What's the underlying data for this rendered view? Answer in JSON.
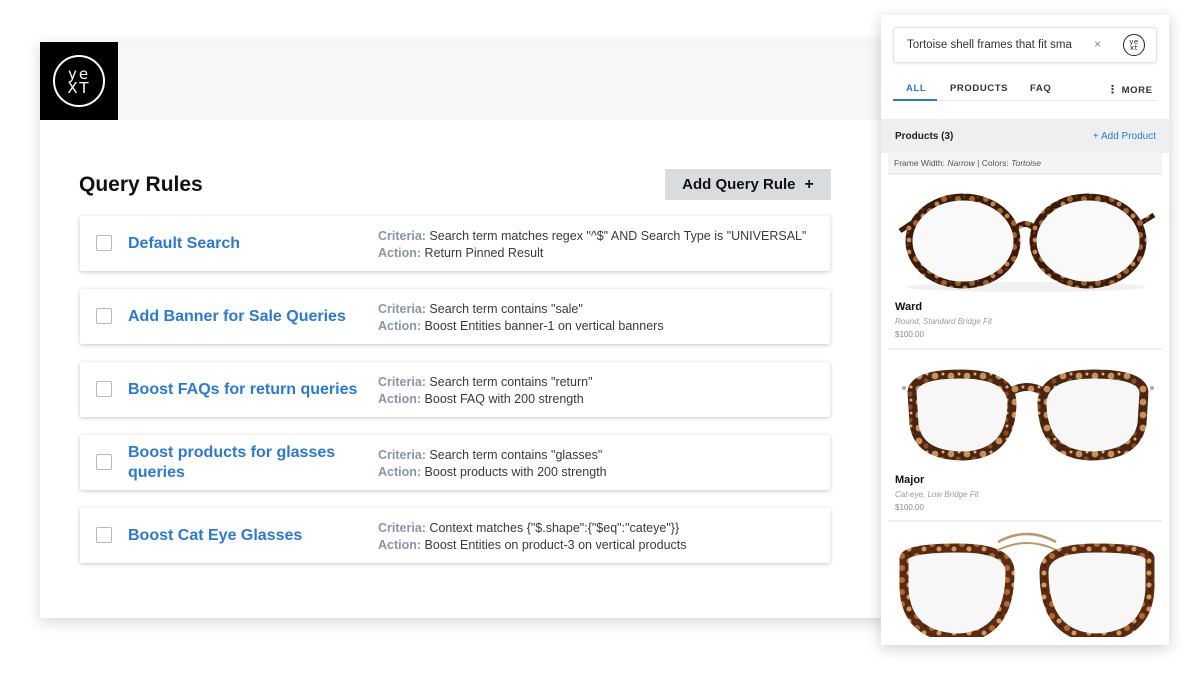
{
  "logo": {
    "line1": "ye",
    "line2": "XT"
  },
  "page": {
    "title": "Query Rules",
    "add_rule_label": "Add Query Rule",
    "add_rule_icon": "+"
  },
  "rules": [
    {
      "name": "Default Search",
      "criteria_label": "Criteria:",
      "criteria": "Search term matches regex \"^$\" AND Search Type is \"UNIVERSAL\"",
      "action_label": "Action:",
      "action": "Return Pinned Result"
    },
    {
      "name": "Add Banner for Sale Queries",
      "criteria_label": "Criteria:",
      "criteria": "Search term contains \"sale\"",
      "action_label": "Action:",
      "action": "Boost Entities banner-1 on vertical banners"
    },
    {
      "name": "Boost FAQs for return queries",
      "criteria_label": "Criteria:",
      "criteria": "Search term contains \"return\"",
      "action_label": "Action:",
      "action": "Boost FAQ with 200 strength"
    },
    {
      "name": "Boost products for glasses queries",
      "criteria_label": "Criteria:",
      "criteria": "Search term contains \"glasses\"",
      "action_label": "Action:",
      "action": "Boost products with 200 strength"
    },
    {
      "name": "Boost Cat Eye Glasses",
      "criteria_label": "Criteria:",
      "criteria": "Context matches {\"$.shape\":{\"$eq\":\"cateye\"}}",
      "action_label": "Action:",
      "action": "Boost Entities on product-3 on vertical products"
    }
  ],
  "search": {
    "query": "Tortoise shell frames that fit sma",
    "clear_icon": "×",
    "logo_line1": "ye",
    "logo_line2": "xt",
    "tabs": [
      {
        "label": "ALL",
        "active": true
      },
      {
        "label": "PRODUCTS",
        "active": false
      },
      {
        "label": "FAQ",
        "active": false
      }
    ],
    "more_label": "MORE",
    "more_icon": "⋮"
  },
  "products_section": {
    "title": "Products (3)",
    "add_label": "+ Add Product",
    "filter": {
      "width_label": "Frame Width:",
      "width_value": "Narrow",
      "separator": "|",
      "colors_label": "Colors:",
      "colors_value": "Tortoise"
    }
  },
  "products": [
    {
      "name": "Ward",
      "subtitle": "Round, Standard Bridge Fit",
      "price": "$100.00"
    },
    {
      "name": "Major",
      "subtitle": "Cat-eye, Low Bridge Fit",
      "price": "$100.00"
    },
    {
      "name": "",
      "subtitle": "",
      "price": ""
    }
  ],
  "colors": {
    "link_blue": "#2a7ad3",
    "label_gray": "#8a96a3",
    "button_gray": "#d9dcdf",
    "tortoise_dark": "#3a1c0e",
    "tortoise_mid": "#8a4a1e",
    "tortoise_light": "#c88a4a"
  }
}
